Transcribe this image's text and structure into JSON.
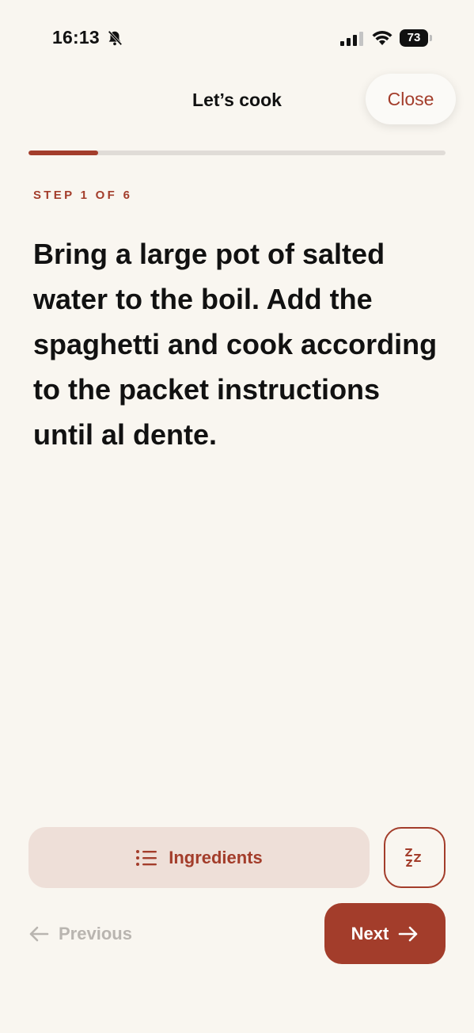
{
  "status_bar": {
    "time": "16:13",
    "battery_level": "73",
    "icons": [
      "bell-slash-icon",
      "signal-icon",
      "wifi-icon",
      "battery-icon"
    ]
  },
  "header": {
    "title": "Let’s cook",
    "close_label": "Close"
  },
  "progress": {
    "current_step": 1,
    "total_steps": 6,
    "fraction": 0.167
  },
  "step": {
    "label": "STEP 1 OF 6",
    "text": "Bring a large pot of salted water to the boil. Add the spaghetti and cook according to the packet instructions until al dente."
  },
  "actions": {
    "ingredients_label": "Ingredients",
    "ingredients_icon": "list-icon",
    "sleep_icon": "zzz-icon",
    "previous_label": "Previous",
    "next_label": "Next"
  },
  "colors": {
    "accent": "#a33d2b",
    "background": "#f9f6f0",
    "ingredients_bg": "#eedfd8",
    "disabled_text": "#b9b5b0",
    "track": "#e0dcd7"
  }
}
